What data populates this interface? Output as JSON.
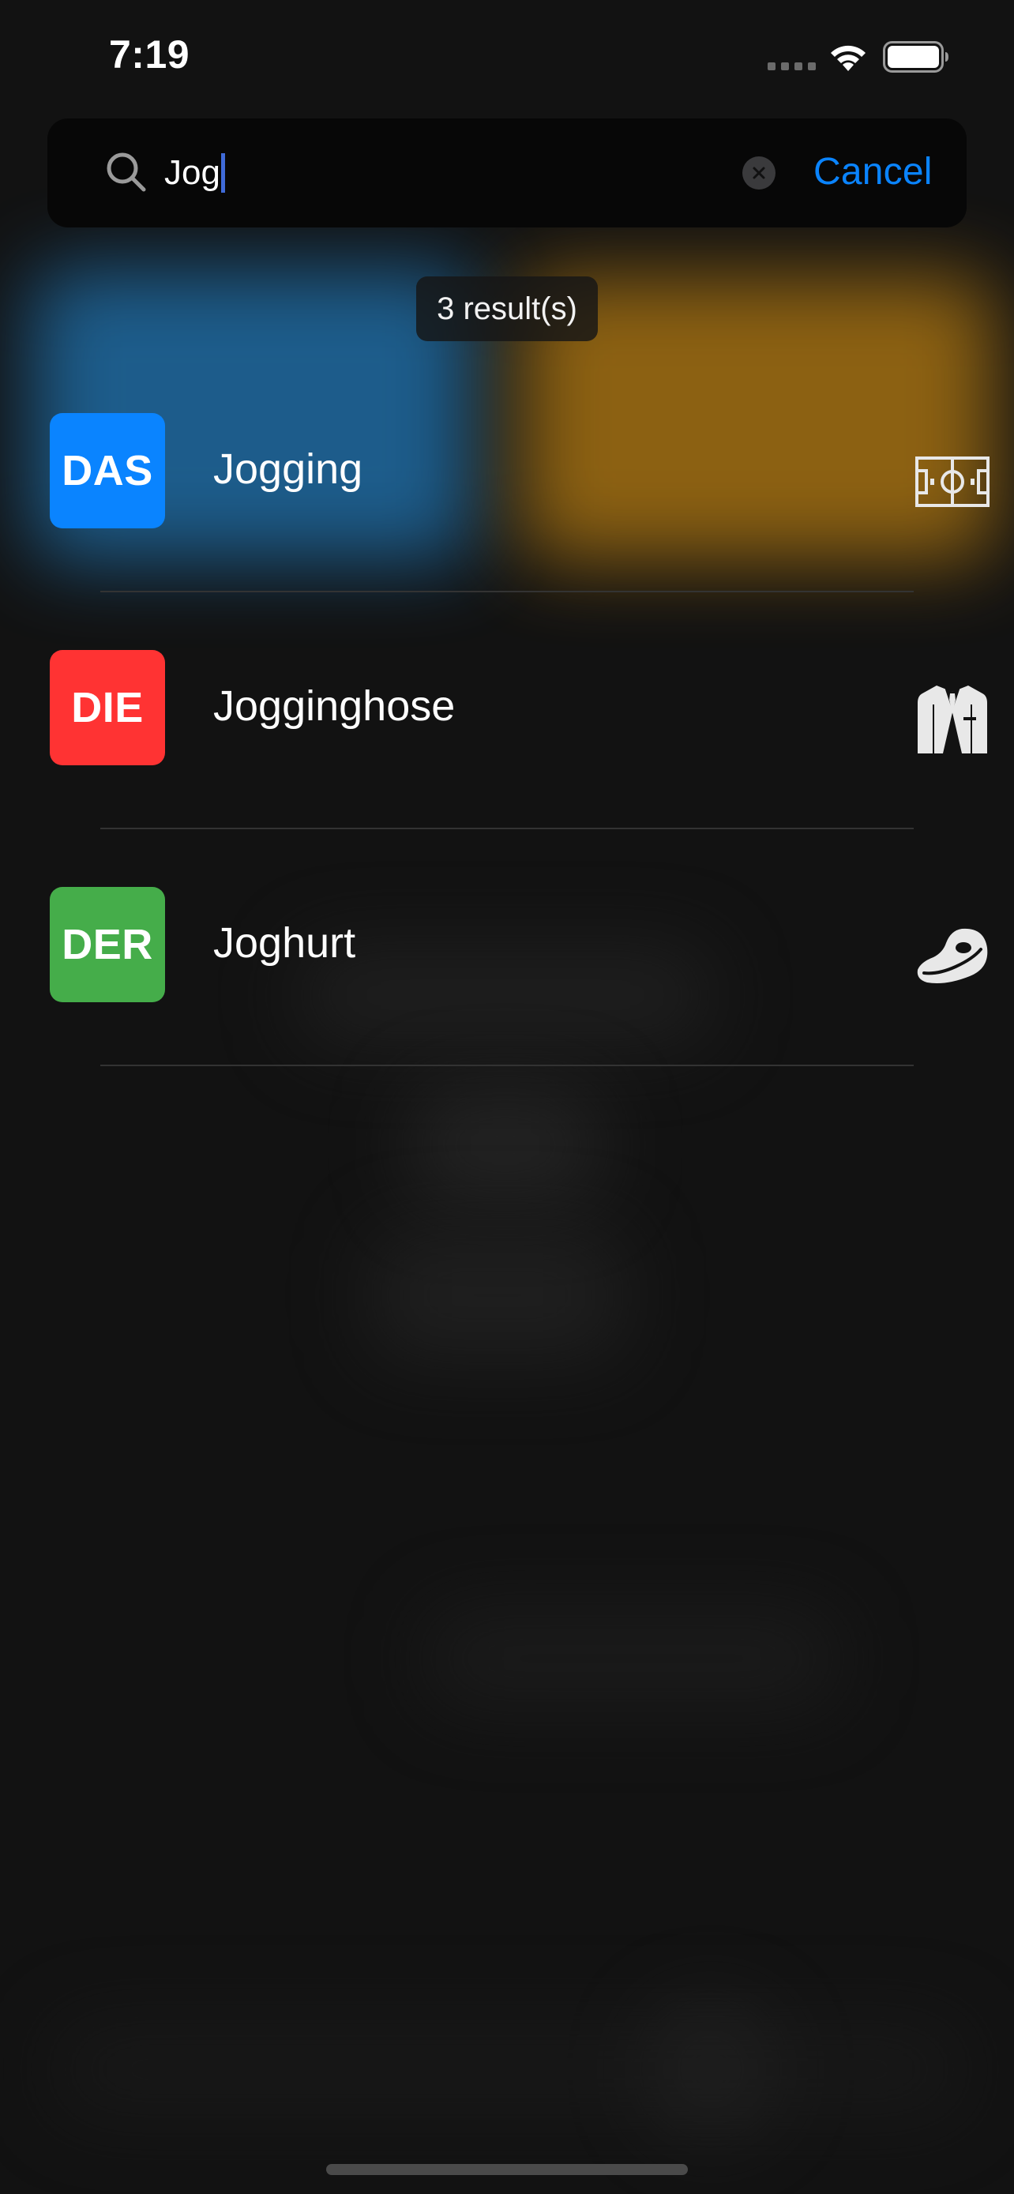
{
  "status_bar": {
    "time": "7:19"
  },
  "search": {
    "value": "Jog",
    "cancel_label": "Cancel"
  },
  "results": {
    "count_label": "3 result(s)",
    "items": [
      {
        "article": "DAS",
        "word": "Jogging",
        "article_color": "#0a84ff",
        "category_icon": "soccer-field-icon"
      },
      {
        "article": "DIE",
        "word": "Jogginghose",
        "article_color": "#ff3333",
        "category_icon": "suit-jacket-icon"
      },
      {
        "article": "DER",
        "word": "Joghurt",
        "article_color": "#45ad4a",
        "category_icon": "steak-icon"
      }
    ]
  },
  "colors": {
    "accent": "#0a84ff",
    "background": "#121212"
  }
}
